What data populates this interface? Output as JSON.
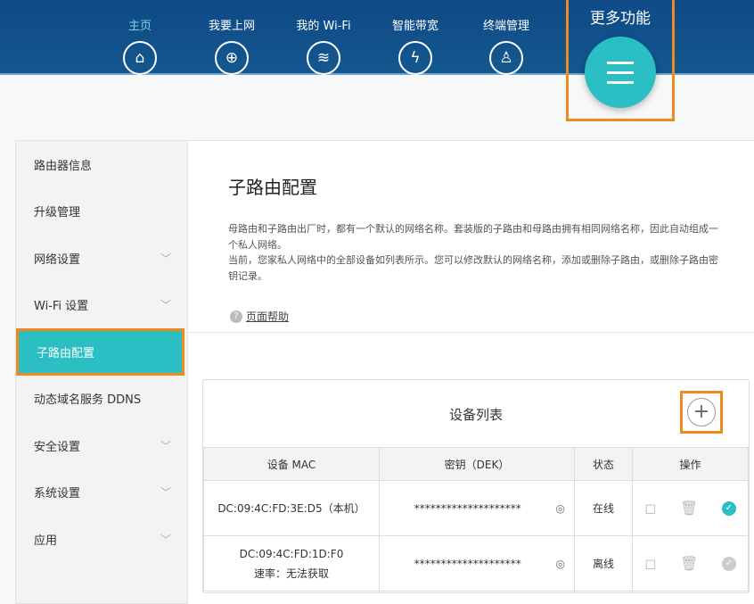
{
  "nav": {
    "items": [
      {
        "label": "主页",
        "icon": "home-icon"
      },
      {
        "label": "我要上网",
        "icon": "globe-icon"
      },
      {
        "label": "我的 Wi-Fi",
        "icon": "wifi-icon"
      },
      {
        "label": "智能带宽",
        "icon": "bandwidth-icon"
      },
      {
        "label": "终端管理",
        "icon": "user-icon"
      }
    ],
    "more": "更多功能"
  },
  "sidebar": {
    "items": [
      {
        "label": "路由器信息"
      },
      {
        "label": "升级管理"
      },
      {
        "label": "网络设置"
      },
      {
        "label": "Wi-Fi 设置"
      },
      {
        "label": "子路由配置"
      },
      {
        "label": "动态域名服务 DDNS"
      },
      {
        "label": "安全设置"
      },
      {
        "label": "系统设置"
      },
      {
        "label": "应用"
      }
    ]
  },
  "main": {
    "title": "子路由配置",
    "desc1": "母路由和子路由出厂时，都有一个默认的网络名称。套装版的子路由和母路由拥有相同网络名称，因此自动组成一个私人网络。",
    "desc2": "当前，您家私人网络中的全部设备如列表所示。您可以修改默认的网络名称，添加或删除子路由，或删除子路由密钥记录。",
    "help": "页面帮助"
  },
  "devices": {
    "title": "设备列表",
    "columns": [
      "设备 MAC",
      "密钥（DEK）",
      "状态",
      "操作"
    ],
    "rows": [
      {
        "mac": "DC:09:4C:FD:3E:D5（本机）",
        "rate": "",
        "key": "********************",
        "status": "在线"
      },
      {
        "mac": "DC:09:4C:FD:1D:F0",
        "rate": "速率：无法获取",
        "key": "********************",
        "status": "离线"
      }
    ]
  },
  "colors": {
    "accent": "#2bbfc4",
    "header": "#0f4a86",
    "highlight": "#f08a1c"
  }
}
